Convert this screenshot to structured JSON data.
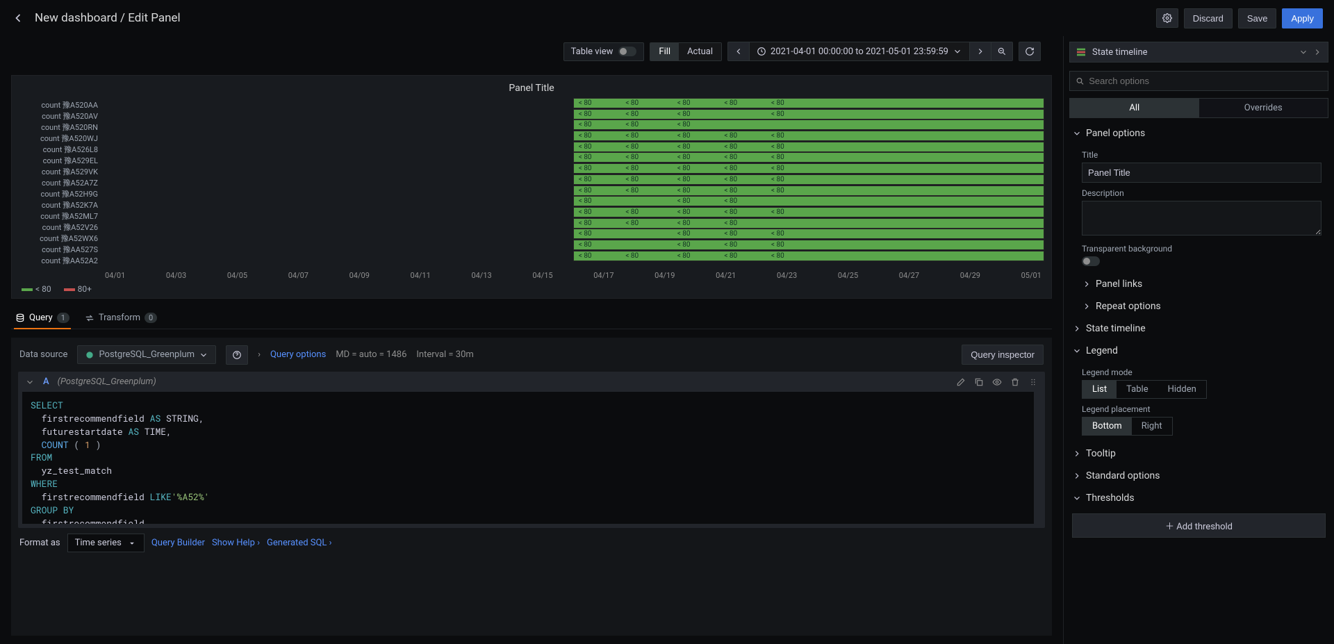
{
  "breadcrumb": "New dashboard / Edit Panel",
  "topbar": {
    "discard": "Discard",
    "save": "Save",
    "apply": "Apply"
  },
  "subbar": {
    "tableView": "Table view",
    "fill": "Fill",
    "actual": "Actual",
    "timeRange": "2021-04-01 00:00:00 to 2021-05-01 23:59:59"
  },
  "panel": {
    "title": "Panel Title",
    "legend": {
      "under80": "< 80",
      "over80": "80+"
    }
  },
  "chart_data": {
    "type": "table",
    "title": "Panel Title",
    "xlabel": "",
    "ylabel": "",
    "x_range": [
      "2021-04-01",
      "2021-05-01"
    ],
    "x_ticks": [
      "04/01",
      "04/03",
      "04/05",
      "04/07",
      "04/09",
      "04/11",
      "04/13",
      "04/15",
      "04/17",
      "04/19",
      "04/21",
      "04/23",
      "04/25",
      "04/27",
      "04/29",
      "05/01"
    ],
    "state_value": "< 80",
    "legend": [
      {
        "label": "< 80",
        "color": "#5aa64b"
      },
      {
        "label": "80+",
        "color": "#c4504e"
      }
    ],
    "series": [
      {
        "name": "count 豫A520AA",
        "state": "< 80",
        "tick_labels_at": [
          0,
          1,
          2,
          3,
          4
        ]
      },
      {
        "name": "count 豫A520AV",
        "state": "< 80",
        "tick_labels_at": [
          0,
          1,
          2,
          4
        ]
      },
      {
        "name": "count 豫A520RN",
        "state": "< 80",
        "tick_labels_at": [
          0,
          1,
          2
        ]
      },
      {
        "name": "count 豫A520WJ",
        "state": "< 80",
        "tick_labels_at": [
          0,
          1,
          2,
          3,
          4
        ]
      },
      {
        "name": "count 豫A526L8",
        "state": "< 80",
        "tick_labels_at": [
          0,
          1,
          2,
          3,
          4
        ]
      },
      {
        "name": "count 豫A529EL",
        "state": "< 80",
        "tick_labels_at": [
          0,
          1,
          2,
          3,
          4
        ]
      },
      {
        "name": "count 豫A529VK",
        "state": "< 80",
        "tick_labels_at": [
          0,
          1,
          2,
          3,
          4
        ]
      },
      {
        "name": "count 豫A52A7Z",
        "state": "< 80",
        "tick_labels_at": [
          0,
          1,
          2,
          3,
          4
        ]
      },
      {
        "name": "count 豫A52H9G",
        "state": "< 80",
        "tick_labels_at": [
          0,
          1,
          2,
          3,
          4
        ]
      },
      {
        "name": "count 豫A52K7A",
        "state": "< 80",
        "tick_labels_at": [
          0,
          2,
          3
        ]
      },
      {
        "name": "count 豫A52ML7",
        "state": "< 80",
        "tick_labels_at": [
          0,
          1,
          2,
          3,
          4
        ]
      },
      {
        "name": "count 豫A52V26",
        "state": "< 80",
        "tick_labels_at": [
          0,
          1,
          2,
          3
        ]
      },
      {
        "name": "count 豫A52WX6",
        "state": "< 80",
        "tick_labels_at": [
          0,
          2,
          3,
          4
        ]
      },
      {
        "name": "count 豫AA527S",
        "state": "< 80",
        "tick_labels_at": [
          0,
          2,
          3,
          4
        ]
      },
      {
        "name": "count 豫AA52A2",
        "state": "< 80",
        "tick_labels_at": [
          0,
          1,
          2,
          3,
          4
        ]
      }
    ]
  },
  "tabs": {
    "query": "Query",
    "queryCount": "1",
    "transform": "Transform",
    "transformCount": "0"
  },
  "querybar": {
    "dsLabel": "Data source",
    "dsName": "PostgreSQL_Greenplum",
    "queryOptions": "Query options",
    "md": "MD = auto = 1486",
    "interval": "Interval = 30m",
    "inspector": "Query inspector"
  },
  "queryRow": {
    "letter": "A",
    "dsName": "(PostgreSQL_Greenplum)"
  },
  "sql": {
    "l1a": "SELECT",
    "l2a": "  firstrecommendfield ",
    "l2b": "AS",
    "l2c": " STRING,",
    "l3a": "  futurestartdate ",
    "l3b": "AS",
    "l3c": " TIME,",
    "l4a": "  ",
    "l4b": "COUNT",
    "l4c": " ( ",
    "l4d": "1",
    "l4e": " )",
    "l5a": "FROM",
    "l6a": "  yz_test_match",
    "l7a": "WHERE",
    "l8a": "  firstrecommendfield ",
    "l8b": "LIKE",
    "l8c": "'%A52%'",
    "l9a": "GROUP BY",
    "l10a": "  firstrecommendfield,"
  },
  "queryFooter": {
    "formatAs": "Format as",
    "formatValue": "Time series",
    "queryBuilder": "Query Builder",
    "showHelp": "Show Help",
    "generatedSQL": "Generated SQL"
  },
  "right": {
    "vizName": "State timeline",
    "searchPlaceholder": "Search options",
    "all": "All",
    "overrides": "Overrides",
    "panelOptions": "Panel options",
    "titleLabel": "Title",
    "titleValue": "Panel Title",
    "descLabel": "Description",
    "transparent": "Transparent background",
    "panelLinks": "Panel links",
    "repeatOptions": "Repeat options",
    "stateTimeline": "State timeline",
    "legend": "Legend",
    "legendMode": "Legend mode",
    "modeList": "List",
    "modeTable": "Table",
    "modeHidden": "Hidden",
    "legendPlacement": "Legend placement",
    "placeBottom": "Bottom",
    "placeRight": "Right",
    "tooltip": "Tooltip",
    "standardOptions": "Standard options",
    "thresholds": "Thresholds",
    "addThreshold": "Add threshold"
  }
}
